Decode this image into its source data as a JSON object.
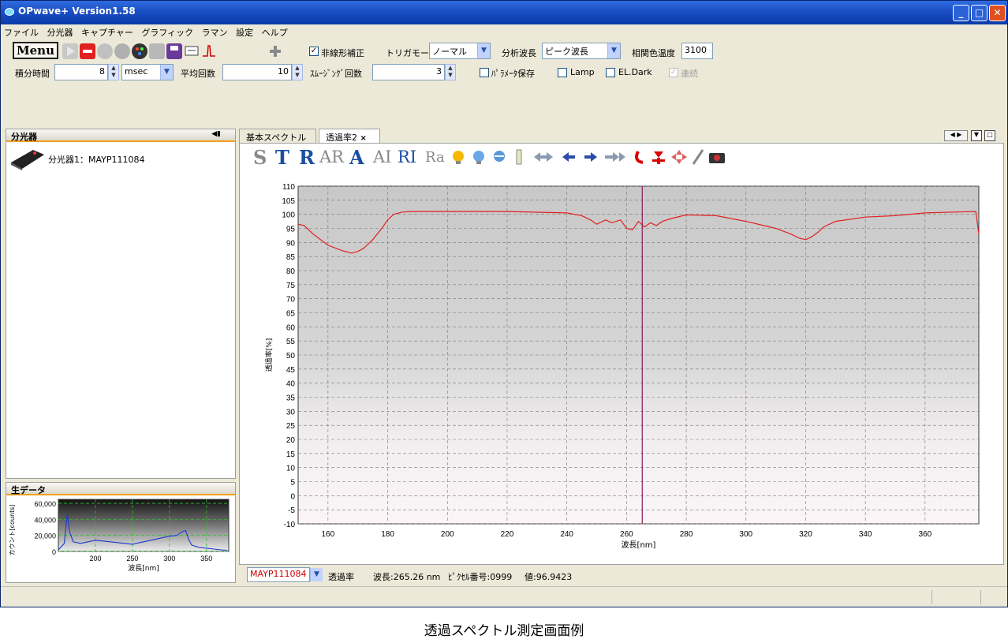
{
  "window": {
    "title": "OPwave+ Version1.58"
  },
  "menu": [
    "ファイル",
    "分光器",
    "キャプチャー",
    "グラフィック",
    "ラマン",
    "設定",
    "ヘルプ"
  ],
  "toolbar": {
    "menu_label": "Menu",
    "nonlinear_label": "非線形補正",
    "nonlinear_checked": true,
    "trigger_label": "トリガモード",
    "trigger_value": "ノーマル",
    "analysis_label": "分析波長",
    "analysis_value": "ピーク波長",
    "cct_label": "相関色温度",
    "cct_value": "3100",
    "integration_label": "積分時間",
    "integration_value": "8",
    "integration_unit": "msec",
    "average_label": "平均回数",
    "average_value": "10",
    "smoothing_label": "ｽﾑｰｼﾞﾝｸﾞ回数",
    "smoothing_value": "3",
    "param_save_label": "ﾊﾟﾗﾒｰﾀ保存",
    "lamp_label": "Lamp",
    "eldark_label": "EL.Dark",
    "continuous_label": "連続"
  },
  "left_panel": {
    "title": "分光器",
    "device": "分光器1：MAYP111084"
  },
  "raw_panel": {
    "title": "生データ",
    "chart_data": {
      "type": "line",
      "xlabel": "波長[nm]",
      "ylabel": "カウント[counts]",
      "xlim": [
        150,
        380
      ],
      "ylim": [
        0,
        65000
      ],
      "xticks": [
        "200",
        "250",
        "300",
        "350"
      ],
      "yticks": [
        "60,000",
        "40,000",
        "20,000",
        "0"
      ],
      "series": [
        {
          "x": [
            150,
            158,
            162,
            165,
            170,
            180,
            200,
            230,
            250,
            260,
            270,
            280,
            290,
            300,
            310,
            318,
            322,
            326,
            330,
            340,
            350,
            360,
            370,
            378
          ],
          "y": [
            2000,
            10000,
            47000,
            25000,
            12000,
            10000,
            14000,
            11000,
            9000,
            11000,
            13000,
            15000,
            17000,
            19000,
            20000,
            25000,
            26000,
            15000,
            8000,
            5000,
            4000,
            3000,
            2000,
            1500
          ]
        }
      ]
    }
  },
  "tabs": [
    "基本スペクトル",
    "透過率2"
  ],
  "tab_close": "×",
  "icon_letters": [
    "S",
    "T",
    "R",
    "AR",
    "A",
    "AI",
    "RI",
    "Ra"
  ],
  "chart_data": {
    "type": "line",
    "xlabel": "波長[nm]",
    "ylabel": "透過率[%]",
    "xlim": [
      150,
      378
    ],
    "ylim": [
      -10,
      110
    ],
    "xticks": [
      160,
      180,
      200,
      220,
      240,
      260,
      280,
      300,
      320,
      340,
      360
    ],
    "yticks": [
      110,
      105,
      100,
      95,
      90,
      85,
      80,
      75,
      70,
      65,
      60,
      55,
      50,
      45,
      40,
      35,
      30,
      25,
      20,
      15,
      10,
      5,
      0,
      -5,
      -10
    ],
    "grid": true,
    "cursor_x": 265.26,
    "series": [
      {
        "x": [
          150,
          152,
          155,
          160,
          165,
          168,
          170,
          172,
          175,
          178,
          180,
          182,
          185,
          188,
          190,
          200,
          220,
          240,
          245,
          248,
          250,
          253,
          255,
          258,
          260,
          262,
          264,
          265,
          266,
          268,
          270,
          272,
          275,
          280,
          290,
          300,
          310,
          315,
          318,
          320,
          322,
          324,
          326,
          330,
          340,
          350,
          360,
          370,
          377,
          378
        ],
        "y": [
          96.5,
          96,
          93,
          89,
          87,
          86.2,
          86.8,
          88,
          91,
          95,
          98,
          100,
          100.8,
          101,
          101,
          101,
          101,
          100.5,
          99.5,
          98,
          96.5,
          98,
          97,
          98,
          95,
          94.5,
          97.5,
          96.5,
          95.5,
          97,
          96,
          97.5,
          98.5,
          99.8,
          99.5,
          97.5,
          95,
          93,
          91.5,
          91,
          92,
          93.5,
          95.5,
          97.5,
          99,
          99.5,
          100.5,
          100.8,
          101,
          93
        ]
      }
    ]
  },
  "status": {
    "device": "MAYP111084",
    "mode": "透過率",
    "wavelength": "波長:265.26 nm",
    "pixel": "ﾋﾟｸｾﾙ番号:0999",
    "value": "値:96.9423"
  },
  "caption": "透過スペクトル測定画面例"
}
